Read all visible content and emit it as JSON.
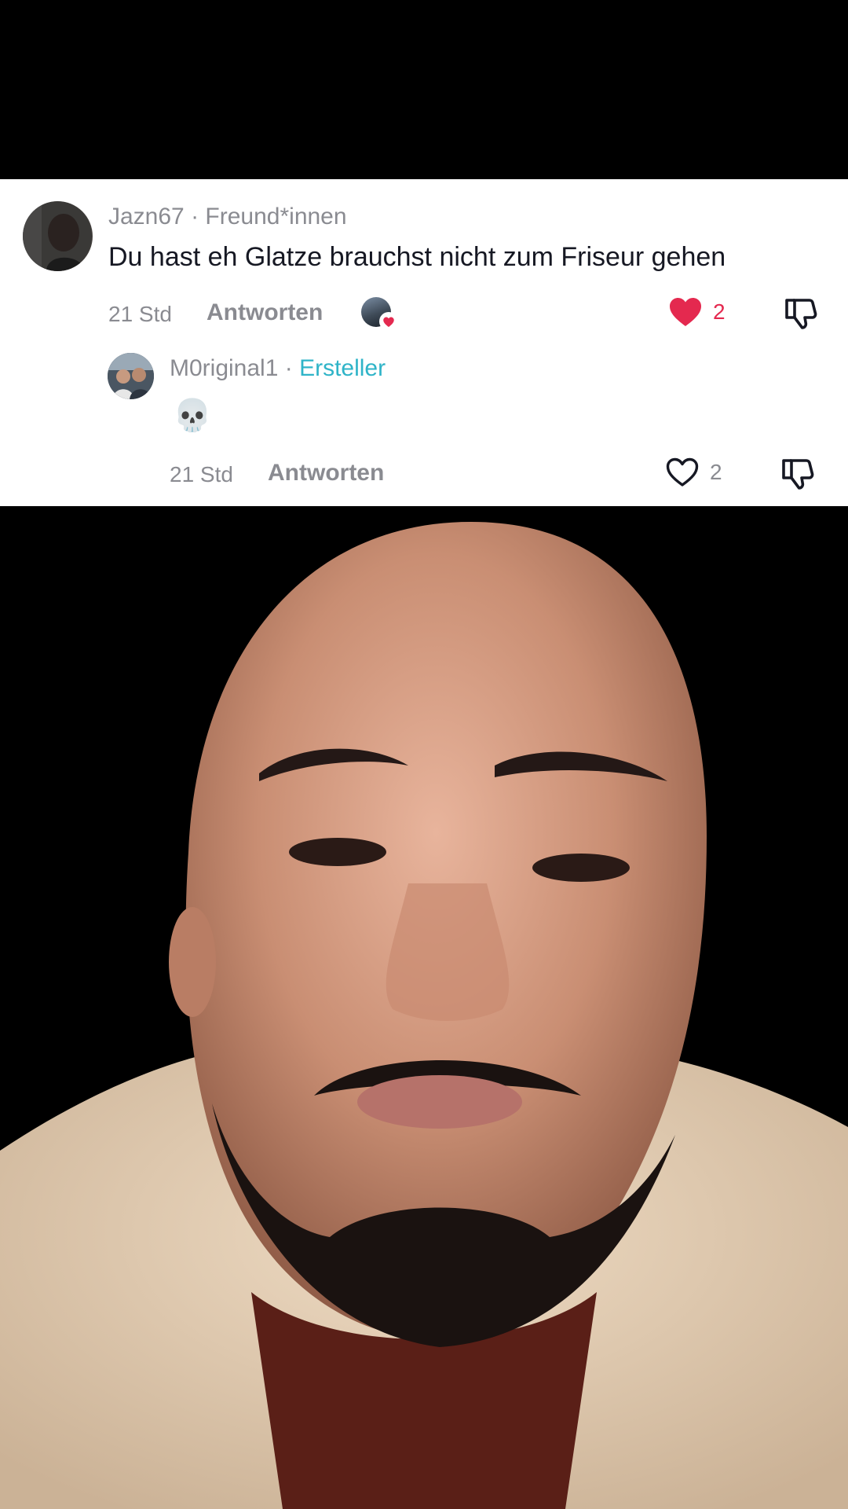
{
  "comment": {
    "username": "Jazn67",
    "separator": " · ",
    "relation": "Freund*innen",
    "text": "Du hast eh Glatze brauchst nicht zum Friseur gehen",
    "time": "21 Std",
    "reply_label": "Antworten",
    "like_count": "2",
    "liked": true,
    "creator_liked": true
  },
  "reply": {
    "username": "M0riginal1",
    "separator": " · ",
    "badge": "Ersteller",
    "text": "💀",
    "time": "21 Std",
    "reply_label": "Antworten",
    "like_count": "2",
    "liked": false
  },
  "colors": {
    "like_active": "#e4294f",
    "creator_badge": "#2fb4c8",
    "muted_text": "#8a8b91",
    "comment_text": "#161823"
  },
  "icons": {
    "like_active": "heart-filled-icon",
    "like_inactive": "heart-outline-icon",
    "dislike": "thumbs-down-icon"
  }
}
